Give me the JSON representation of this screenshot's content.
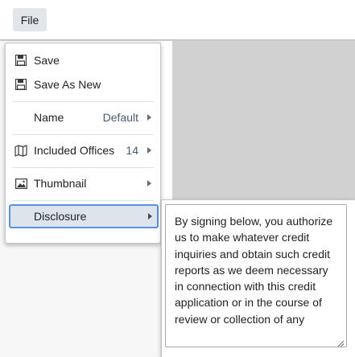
{
  "toolbar": {
    "file_label": "File"
  },
  "menu": {
    "save": {
      "label": "Save",
      "icon": "floppy-disk-icon"
    },
    "save_as_new": {
      "label": "Save As New",
      "icon": "floppy-disk-icon"
    },
    "name": {
      "label": "Name",
      "value": "Default"
    },
    "included_offices": {
      "label": "Included Offices",
      "value": "14",
      "icon": "map-icon"
    },
    "thumbnail": {
      "label": "Thumbnail",
      "icon": "image-icon"
    },
    "disclosure": {
      "label": "Disclosure"
    }
  },
  "disclosure": {
    "text": "By signing below, you authorize us to make whatever credit inquiries and obtain such credit reports as we deem necessary in connection with this credit application or in the course of review or collection of any"
  },
  "colors": {
    "background": "#d1d1d1",
    "active_border": "#5b8fdf",
    "active_fill": "#dde4ec"
  }
}
